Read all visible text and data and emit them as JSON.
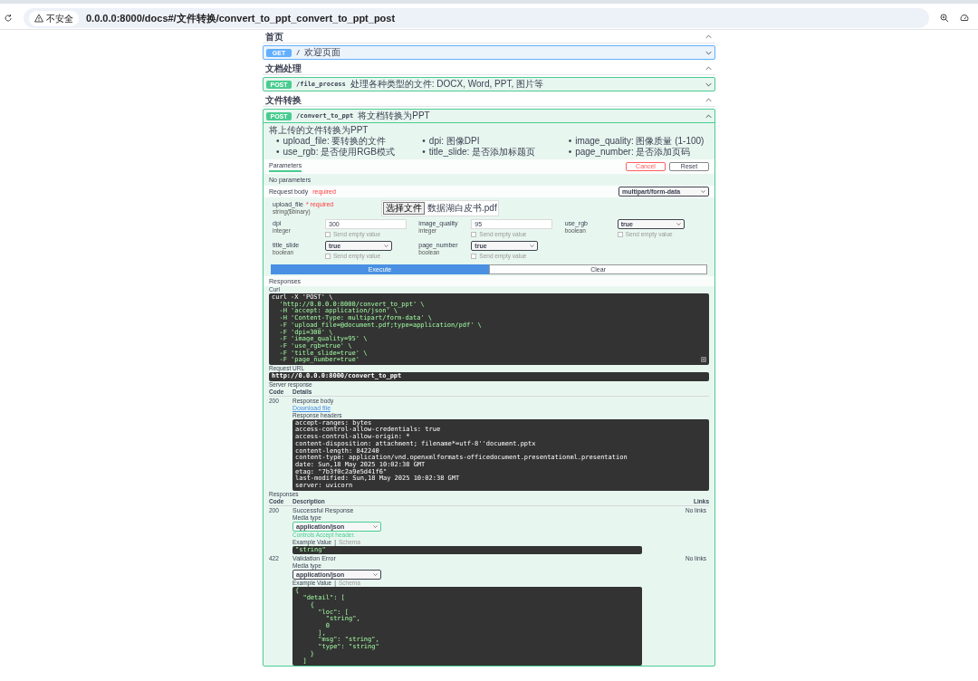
{
  "browser": {
    "security_label": "不安全",
    "url": "0.0.0.0:8000/docs#/文件转换/convert_to_ppt_convert_to_ppt_post"
  },
  "sections": [
    {
      "title": "首页",
      "expanded": true,
      "operations": [
        {
          "method": "GET",
          "path": "/",
          "summary": "欢迎页面",
          "expanded": false
        }
      ]
    },
    {
      "title": "文档处理",
      "expanded": true,
      "operations": [
        {
          "method": "POST",
          "path": "/file_process",
          "summary": "处理各种类型的文件: DOCX, Word, PPT, 图片等",
          "expanded": false
        }
      ]
    },
    {
      "title": "文件转换",
      "expanded": true,
      "operations": [
        {
          "method": "POST",
          "path": "/convert_to_ppt",
          "summary": "将文档转换为PPT",
          "expanded": true
        }
      ]
    }
  ],
  "detail": {
    "description": "将上传的文件转换为PPT",
    "note_marker": "•",
    "notes": [
      "upload_file: 要转换的文件",
      "dpi: 图像DPI",
      "image_quality: 图像质量 (1-100)",
      "use_rgb: 是否使用RGB模式",
      "title_slide: 是否添加标题页",
      "page_number: 是否添加页码"
    ],
    "tabs": [
      {
        "label": "Parameters",
        "selected": true
      }
    ],
    "cancel": "Cancel",
    "reset": "Reset",
    "no_params": "No parameters",
    "request_body": "Request body",
    "request_body_required": "required",
    "content_type": "multipart/form-data",
    "fields": [
      {
        "kind": "file",
        "name": "upload_file",
        "required": "* required",
        "type": "string($binary)",
        "button": "选择文件",
        "filename": "数据湖白皮书.pdf"
      },
      {
        "kind": "text",
        "name": "dpi",
        "type": "integer",
        "value": "300",
        "send_empty": "Send empty value",
        "checked": false
      },
      {
        "kind": "text",
        "name": "image_quality",
        "type": "integer",
        "value": "95",
        "send_empty": "Send empty value",
        "checked": false
      },
      {
        "kind": "select",
        "name": "use_rgb",
        "type": "boolean",
        "value": "true",
        "send_empty": "Send empty value",
        "checked": false
      },
      {
        "kind": "select",
        "name": "title_slide",
        "type": "boolean",
        "value": "true",
        "send_empty": "Send empty value",
        "checked": false
      },
      {
        "kind": "select",
        "name": "page_number",
        "type": "boolean",
        "value": "true",
        "send_empty": "Send empty value",
        "checked": false
      }
    ],
    "execute": "Execute",
    "clear": "Clear",
    "responses_heading": "Responses",
    "curl_label": "Curl",
    "curl": [
      "curl -X 'POST' \\",
      "  'http://0.0.0.0:8000/convert_to_ppt' \\",
      "  -H 'accept: application/json' \\",
      "  -H 'Content-Type: multipart/form-data' \\",
      "  -F 'upload_file=@document.pdf;type=application/pdf' \\",
      "  -F 'dpi=300' \\",
      "  -F 'image_quality=95' \\",
      "  -F 'use_rgb=true' \\",
      "  -F 'title_slide=true' \\",
      "  -F 'page_number=true'"
    ],
    "request_url_label": "Request URL",
    "request_url": "http://0.0.0.0:8000/convert_to_ppt",
    "server_response_label": "Server response",
    "server_columns": [
      "Code",
      "Details"
    ],
    "server_code": "200",
    "body_label": "Response body",
    "download": "Download file",
    "headers_label": "Response headers",
    "headers": [
      "accept-ranges: bytes",
      "access-control-allow-credentials: true",
      "access-control-allow-origin: *",
      "content-disposition: attachment; filename*=utf-8''document.pptx",
      "content-length: 842240",
      "content-type: application/vnd.openxmlformats-officedocument.presentationml.presentation",
      "date: Sun,18 May 2025 10:02:38 GMT",
      "etag: \"7b3f0c2a9e5d41f6\"",
      "last-modified: Sun,18 May 2025 10:02:38 GMT",
      "server: uvicorn"
    ],
    "responses_label": "Responses",
    "response_columns": [
      "Code",
      "Description",
      "Links"
    ],
    "responses": [
      {
        "code": "200",
        "description": "Successful Response",
        "links": "No links",
        "media_label": "Media type",
        "media": "application/json",
        "accept_note": "Controls Accept header.",
        "example_tabs": [
          "Example Value",
          "|",
          "Schema"
        ],
        "example": [
          "\"string\""
        ]
      },
      {
        "code": "422",
        "description": "Validation Error",
        "links": "No links",
        "media_label": "Media type",
        "media": "application/json",
        "example_tabs": [
          "Example Value",
          "|",
          "Schema"
        ],
        "example": [
          "{",
          "  \"detail\": [",
          "    {",
          "      \"loc\": [",
          "        \"string\",",
          "        0",
          "      ],",
          "      \"msg\": \"string\",",
          "      \"type\": \"string\"",
          "    }",
          "  ]"
        ]
      }
    ]
  }
}
